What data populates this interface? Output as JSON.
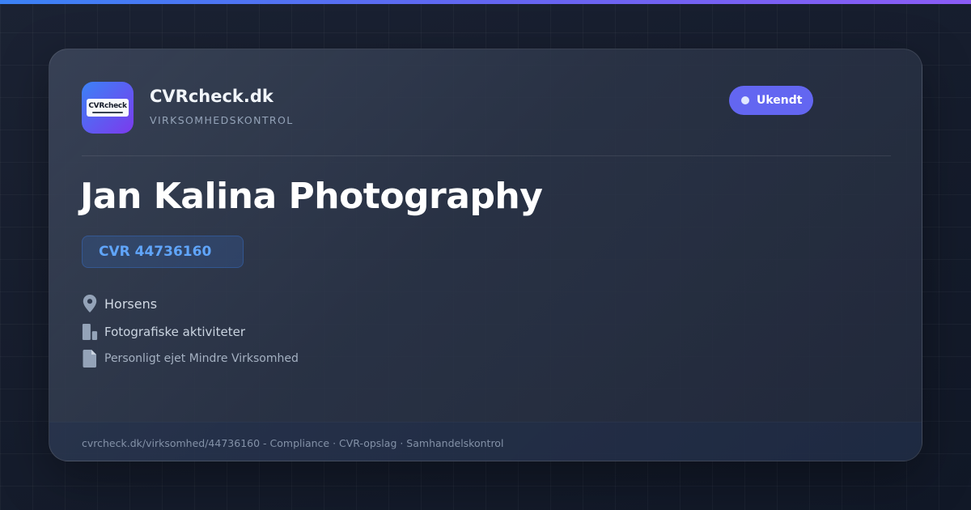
{
  "brand": {
    "logo_text": "CVRcheck",
    "name": "CVRcheck.dk",
    "tagline": "VIRKSOMHEDSKONTROL"
  },
  "status": {
    "label": "Ukendt",
    "color": "#6366f1"
  },
  "company": {
    "name": "Jan Kalina Photography",
    "cvr": "CVR 44736160",
    "city": "Horsens",
    "industry": "Fotografiske aktiviteter",
    "legal_form": "Personligt ejet Mindre Virksomhed"
  },
  "icons": {
    "city": "location-pin-icon",
    "industry": "building-icon",
    "legal_form": "document-icon"
  },
  "footer": {
    "text": "cvrcheck.dk/virksomhed/44736160 - Compliance · CVR-opslag · Samhandelskontrol"
  },
  "colors": {
    "accent": "#6366f1",
    "cvr_text": "#60a5fa",
    "background": "#141b2b"
  }
}
